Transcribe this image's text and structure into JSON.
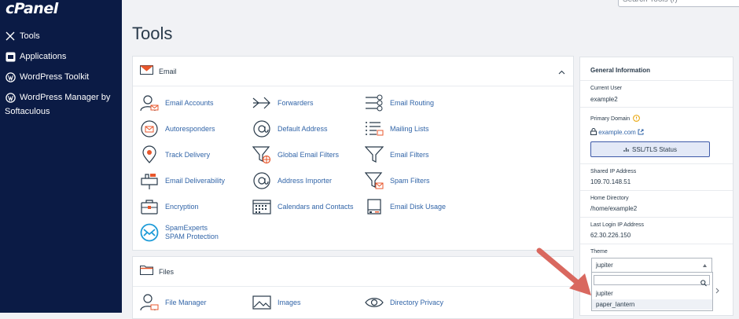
{
  "app": {
    "logo_text": "cPanel"
  },
  "search": {
    "placeholder": "Search Tools (/)"
  },
  "page": {
    "title": "Tools"
  },
  "sidebar": {
    "items": [
      {
        "label": "Tools",
        "icon": "tools-icon"
      },
      {
        "label": "Applications",
        "icon": "applications-icon"
      },
      {
        "label": "WordPress Toolkit",
        "icon": "wordpress-icon"
      },
      {
        "label": "WordPress Manager by Softaculous",
        "icon": "wordpress-icon"
      }
    ]
  },
  "email_section": {
    "title": "Email",
    "tools": [
      {
        "label": "Email Accounts",
        "icon": "email-accounts-icon"
      },
      {
        "label": "Forwarders",
        "icon": "forwarders-icon"
      },
      {
        "label": "Email Routing",
        "icon": "email-routing-icon"
      },
      {
        "label": "Autoresponders",
        "icon": "autoresponders-icon"
      },
      {
        "label": "Default Address",
        "icon": "default-address-icon"
      },
      {
        "label": "Mailing Lists",
        "icon": "mailing-lists-icon"
      },
      {
        "label": "Track Delivery",
        "icon": "track-delivery-icon"
      },
      {
        "label": "Global Email Filters",
        "icon": "global-email-filters-icon"
      },
      {
        "label": "Email Filters",
        "icon": "email-filters-icon"
      },
      {
        "label": "Email Deliverability",
        "icon": "email-deliverability-icon"
      },
      {
        "label": "Address Importer",
        "icon": "address-importer-icon"
      },
      {
        "label": "Spam Filters",
        "icon": "spam-filters-icon"
      },
      {
        "label": "Encryption",
        "icon": "encryption-icon"
      },
      {
        "label": "Calendars and Contacts",
        "icon": "calendars-icon"
      },
      {
        "label": "Email Disk Usage",
        "icon": "disk-usage-icon"
      },
      {
        "label": "SpamExperts SPAM Protection",
        "icon": "spamexperts-icon"
      }
    ]
  },
  "files_section": {
    "title": "Files",
    "tools": [
      {
        "label": "File Manager",
        "icon": "file-manager-icon"
      },
      {
        "label": "Images",
        "icon": "images-icon"
      },
      {
        "label": "Directory Privacy",
        "icon": "directory-privacy-icon"
      }
    ]
  },
  "general_info": {
    "title": "General Information",
    "current_user_label": "Current User",
    "current_user": "example2",
    "primary_domain_label": "Primary Domain",
    "primary_domain": "example.com",
    "ssl_button": "SSL/TLS Status",
    "shared_ip_label": "Shared IP Address",
    "shared_ip": "109.70.148.51",
    "home_dir_label": "Home Directory",
    "home_dir": "/home/example2",
    "last_login_label": "Last Login IP Address",
    "last_login_ip": "62.30.226.150",
    "theme_label": "Theme",
    "theme_selected": "jupiter",
    "theme_options": [
      "jupiter",
      "paper_lantern"
    ]
  },
  "colors": {
    "sidebar_bg": "#0b1b45",
    "link": "#3265a8",
    "email_icon_accent": "#e8572c",
    "annotation_arrow": "#d9685f",
    "dropdown_highlight": "#eef1f6"
  }
}
